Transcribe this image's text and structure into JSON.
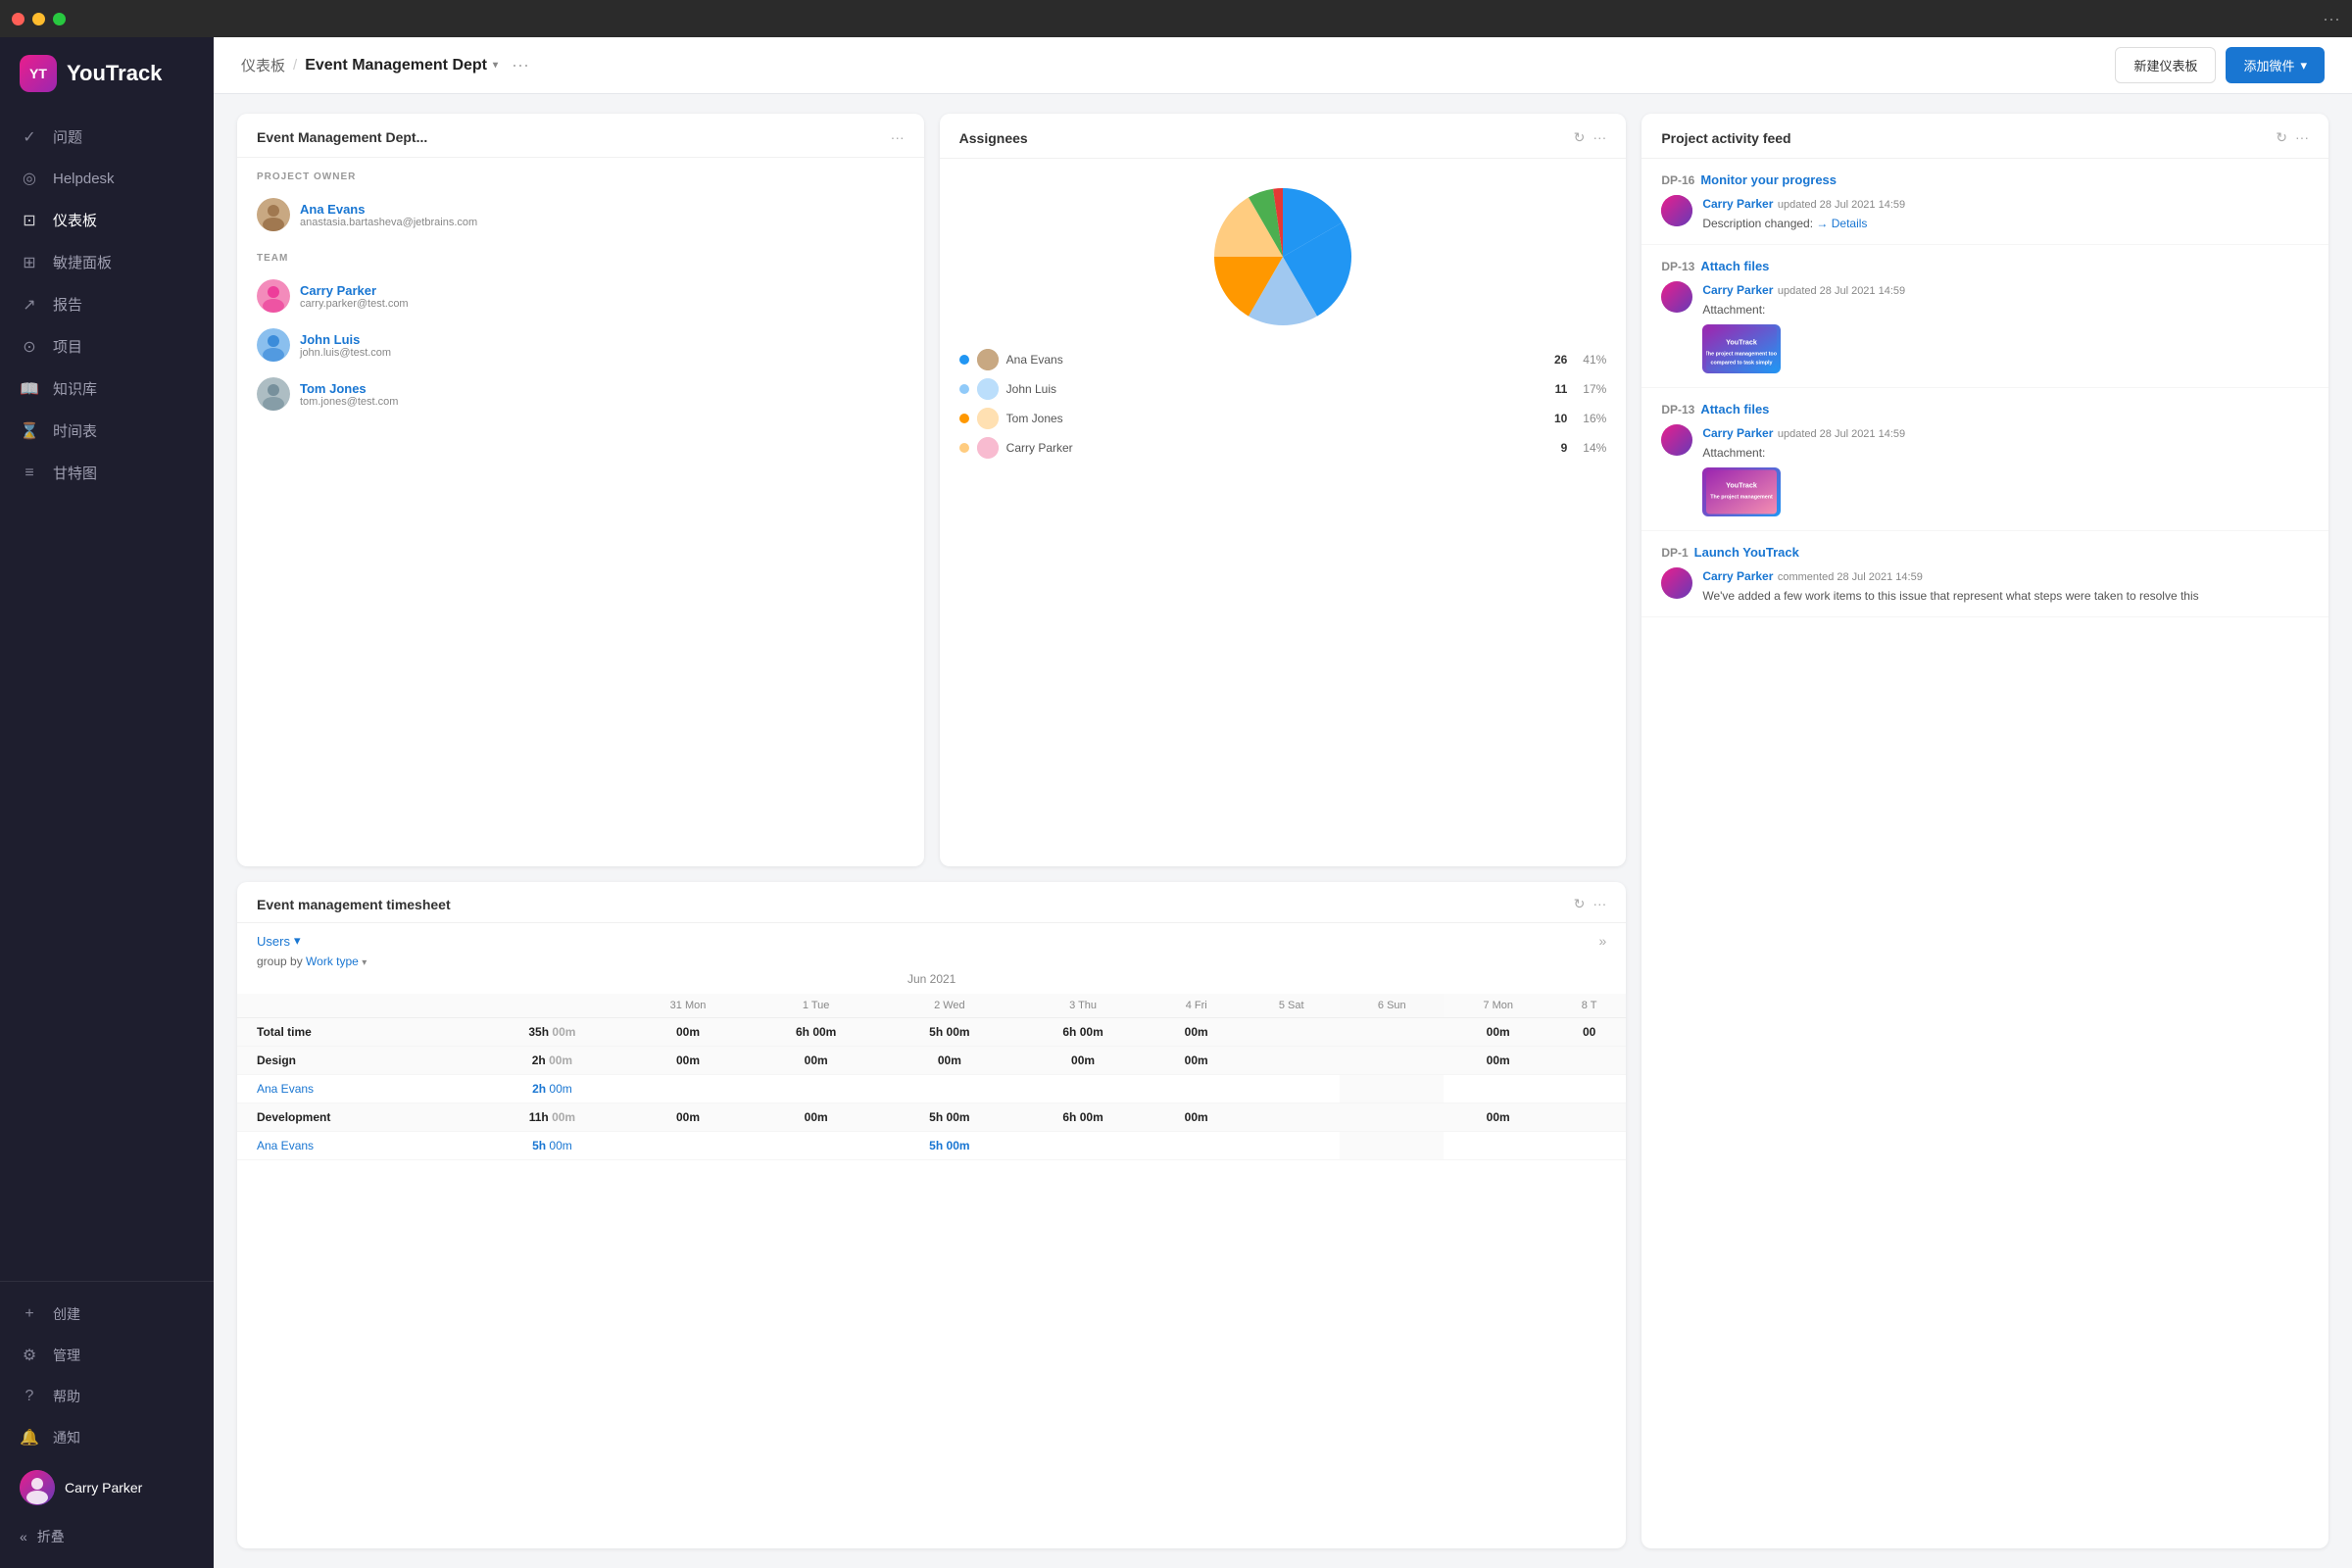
{
  "titlebar": {
    "dots_label": "···"
  },
  "sidebar": {
    "logo_text": "YouTrack",
    "logo_abbr": "YT",
    "nav_items": [
      {
        "id": "issues",
        "label": "问题",
        "icon": "✓"
      },
      {
        "id": "helpdesk",
        "label": "Helpdesk",
        "icon": "○"
      },
      {
        "id": "dashboard",
        "label": "仪表板",
        "icon": "◎",
        "active": true
      },
      {
        "id": "agile",
        "label": "敏捷面板",
        "icon": "⊞"
      },
      {
        "id": "reports",
        "label": "报告",
        "icon": "↗"
      },
      {
        "id": "projects",
        "label": "项目",
        "icon": "⊙"
      },
      {
        "id": "knowledge",
        "label": "知识库",
        "icon": "📖"
      },
      {
        "id": "timesheet",
        "label": "时间表",
        "icon": "⌛"
      },
      {
        "id": "gantt",
        "label": "甘特图",
        "icon": "≡"
      }
    ],
    "bottom_items": [
      {
        "id": "create",
        "label": "创建",
        "icon": "+"
      },
      {
        "id": "admin",
        "label": "管理",
        "icon": "⚙"
      },
      {
        "id": "help",
        "label": "帮助",
        "icon": "?"
      },
      {
        "id": "notifications",
        "label": "通知",
        "icon": "🔔"
      }
    ],
    "user_name": "Carry Parker",
    "collapse_label": "折叠"
  },
  "header": {
    "breadcrumb_root": "仪表板",
    "breadcrumb_sep": "/",
    "breadcrumb_current": "Event Management Dept",
    "chevron": "▾",
    "dots": "···",
    "btn_new": "新建仪表板",
    "btn_add": "添加微件",
    "btn_add_chevron": "▾"
  },
  "project_card": {
    "title": "Event Management Dept...",
    "dots": "···",
    "section_owner": "PROJECT OWNER",
    "owner_name": "Ana Evans",
    "owner_email": "anastasia.bartasheva@jetbrains.com",
    "section_team": "TEAM",
    "team_members": [
      {
        "name": "Carry Parker",
        "email": "carry.parker@test.com",
        "color": "#e91e8c"
      },
      {
        "name": "John Luis",
        "email": "john.luis@test.com",
        "color": "#1976d2"
      },
      {
        "name": "Tom Jones",
        "email": "tom.jones@test.com",
        "color": "#607d8b"
      }
    ]
  },
  "assignees_card": {
    "title": "Assignees",
    "assignees": [
      {
        "name": "Ana Evans",
        "count": 26,
        "pct": "41%",
        "color": "#2196f3",
        "dot_color": "#2196f3"
      },
      {
        "name": "John Luis",
        "count": 11,
        "pct": "17%",
        "color": "#90caf9",
        "dot_color": "#90caf9"
      },
      {
        "name": "Tom Jones",
        "count": 10,
        "pct": "16%",
        "color": "#ff9800",
        "dot_color": "#ff9800"
      },
      {
        "name": "Carry Parker",
        "count": 9,
        "pct": "14%",
        "color": "#ffcc80",
        "dot_color": "#ffcc80"
      }
    ],
    "pie_segments": [
      {
        "label": "Ana Evans",
        "color": "#2196f3",
        "percent": 41
      },
      {
        "label": "John Luis",
        "color": "#90caf9",
        "percent": 17
      },
      {
        "label": "Tom Jones",
        "color": "#ff9800",
        "percent": 16
      },
      {
        "label": "Carry Parker",
        "color": "#ffcc80",
        "percent": 14
      },
      {
        "label": "Other green",
        "color": "#4caf50",
        "percent": 7
      },
      {
        "label": "Other red",
        "color": "#e53935",
        "percent": 5
      }
    ]
  },
  "activity_card": {
    "title": "Project activity feed",
    "items": [
      {
        "id": "DP-16",
        "title": "Monitor your progress",
        "user": "Carry Parker",
        "action": "updated 28 Jul 2021 14:59",
        "desc_label": "Description changed:",
        "desc_link": "→ Details",
        "has_attachment": false,
        "has_desc": true
      },
      {
        "id": "DP-13",
        "title": "Attach files",
        "user": "Carry Parker",
        "action": "updated 28 Jul 2021 14:59",
        "desc_label": "Attachment:",
        "has_attachment": true,
        "has_desc": false
      },
      {
        "id": "DP-13",
        "title": "Attach files",
        "user": "Carry Parker",
        "action": "updated 28 Jul 2021 14:59",
        "desc_label": "Attachment:",
        "has_attachment": true,
        "has_desc": false
      },
      {
        "id": "DP-1",
        "title": "Launch YouTrack",
        "user": "Carry Parker",
        "action": "commented 28 Jul 2021 14:59",
        "desc_label": "We've added a few work items to this issue that represent what steps were taken to resolve this",
        "has_attachment": false,
        "has_desc": true
      }
    ]
  },
  "timesheet_card": {
    "title": "Event management timesheet",
    "users_label": "Users",
    "group_by_label": "group by",
    "work_type_label": "Work type",
    "month_label": "Jun 2021",
    "columns": [
      "",
      "31 Mon",
      "1 Tue",
      "2 Wed",
      "3 Thu",
      "4 Fri",
      "5 Sat",
      "6 Sun",
      "7 Mon",
      "8 T"
    ],
    "rows": [
      {
        "label": "Total time",
        "time": "35h 00m",
        "values": [
          "00m",
          "6h 00m",
          "5h 00m",
          "6h 00m",
          "00m",
          "",
          "",
          "00m",
          "00"
        ],
        "is_section": true
      },
      {
        "label": "Design",
        "time": "2h 00m",
        "values": [
          "00m",
          "00m",
          "00m",
          "00m",
          "00m",
          "",
          "",
          "00m",
          ""
        ],
        "is_section": true
      },
      {
        "label": "Ana Evans",
        "time": "2h 00m",
        "values": [
          "",
          "",
          "",
          "",
          "",
          "",
          "",
          "",
          ""
        ],
        "is_sub": true
      },
      {
        "label": "Development",
        "time": "11h 00m",
        "values": [
          "00m",
          "00m",
          "5h 00m",
          "6h 00m",
          "00m",
          "",
          "",
          "00m",
          ""
        ],
        "is_section": true
      },
      {
        "label": "Ana Evans",
        "time": "5h 00m",
        "values": [
          "",
          "",
          "5h 00m",
          "",
          "",
          "",
          "",
          "",
          ""
        ],
        "is_sub": true
      }
    ]
  }
}
